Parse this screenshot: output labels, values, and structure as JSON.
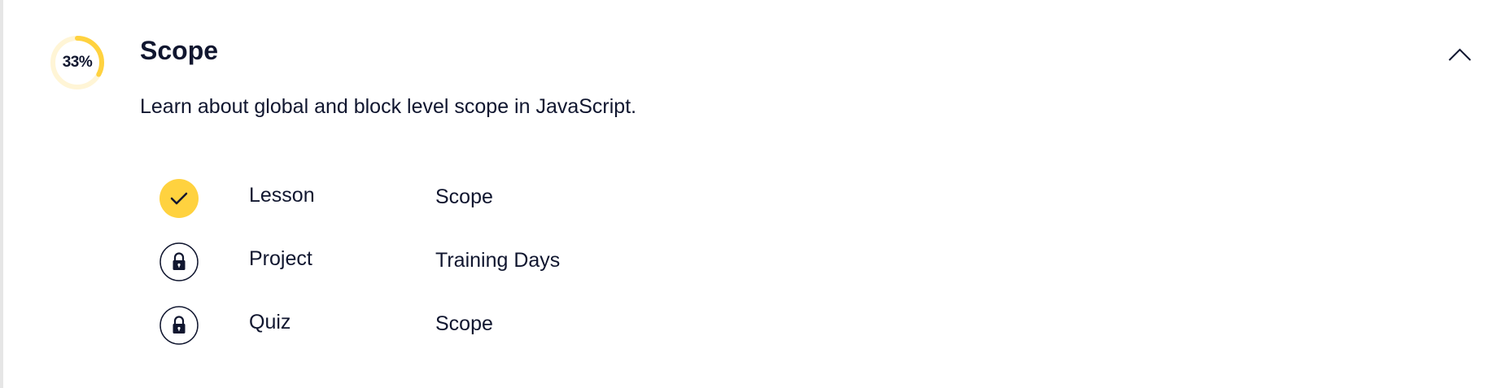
{
  "module": {
    "progress_text": "33%",
    "progress_value": 0.33,
    "title": "Scope",
    "description": "Learn about global and block level scope in JavaScript.",
    "expanded": true
  },
  "items": [
    {
      "type": "Lesson",
      "name": "Scope",
      "status": "completed",
      "status_icon": "check-icon"
    },
    {
      "type": "Project",
      "name": "Training Days",
      "status": "locked",
      "status_icon": "lock-icon"
    },
    {
      "type": "Quiz",
      "name": "Scope",
      "status": "locked",
      "status_icon": "lock-icon"
    }
  ],
  "colors": {
    "accent_yellow": "#ffd23f",
    "track_yellow": "#fff5d6",
    "text": "#10162f",
    "background": "#ffffff"
  }
}
